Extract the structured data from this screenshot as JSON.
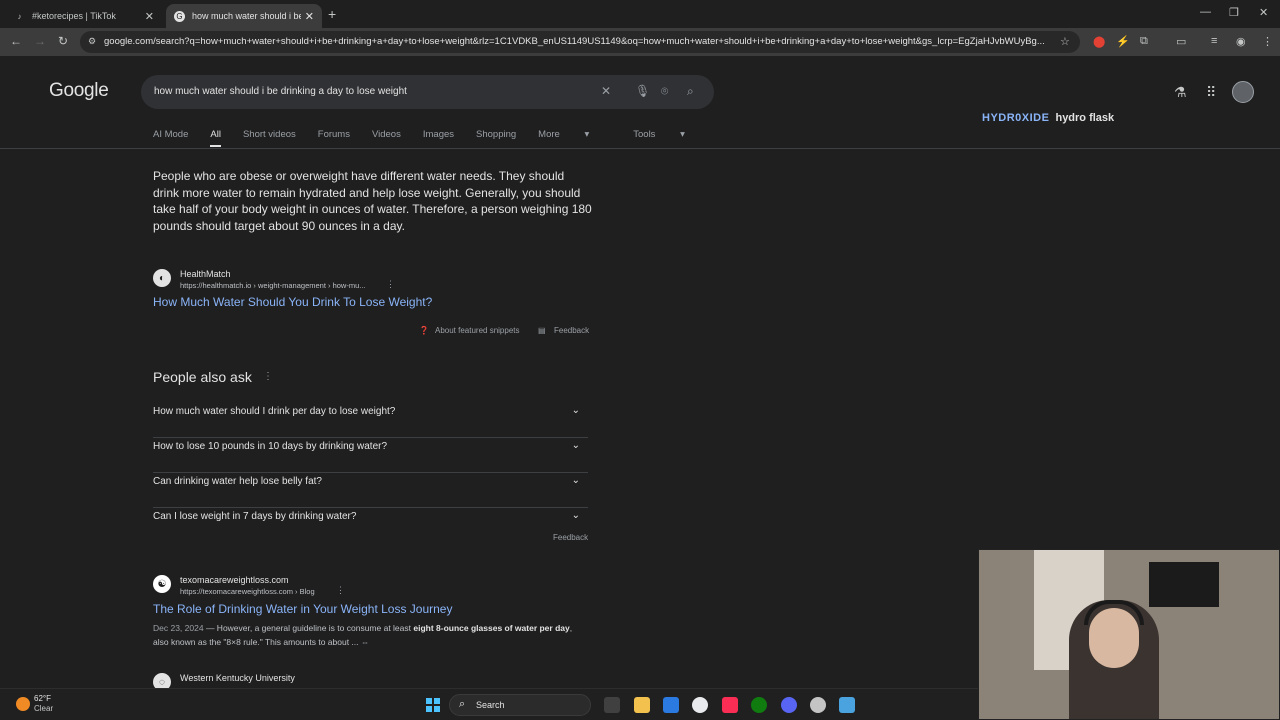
{
  "browser": {
    "tabs": [
      {
        "title": "#ketorecipes | TikTok",
        "active": false
      },
      {
        "title": "how much water should i be dr",
        "active": true
      }
    ],
    "url": "google.com/search?q=how+much+water+should+i+be+drinking+a+day+to+lose+weight&rlz=1C1VDKB_enUS1149US1149&oq=how+much+water+should+i+be+drinking+a+day+to+lose+weight&gs_lcrp=EgZjaHJvbWUyBg..."
  },
  "google": {
    "logo": "Google",
    "query": "how much water should i be drinking a day to lose weight",
    "nav_tabs": [
      "AI Mode",
      "All",
      "Short videos",
      "Forums",
      "Videos",
      "Images",
      "Shopping",
      "More",
      "Tools"
    ],
    "active_tab": "All"
  },
  "ad": {
    "brand1": "HYDR0XIDE",
    "brand2": "hydro flask"
  },
  "featured": {
    "text": "People who are obese or overweight have different water needs. They should drink more water to remain hydrated and help lose weight. Generally, you should take half of your body weight in ounces of water. Therefore, a person weighing 180 pounds should target about 90 ounces in a day.",
    "source_name": "HealthMatch",
    "source_url": "https://healthmatch.io › weight-management › how-mu...",
    "link_title": "How Much Water Should You Drink To Lose Weight?",
    "about_label": "About featured snippets",
    "feedback_label": "Feedback"
  },
  "paa": {
    "title": "People also ask",
    "questions": [
      "How much water should I drink per day to lose weight?",
      "How to lose 10 pounds in 10 days by drinking water?",
      "Can drinking water help lose belly fat?",
      "Can I lose weight in 7 days by drinking water?"
    ],
    "feedback_label": "Feedback"
  },
  "results": [
    {
      "site": "texomacareweightloss.com",
      "url": "https://texomacareweightloss.com › Blog",
      "title": "The Role of Drinking Water in Your Weight Loss Journey",
      "date": "Dec 23, 2024",
      "snippet_pre": " — However, a general guideline is to consume at least ",
      "snippet_bold": "eight 8-ounce glasses of water per day",
      "snippet_post": ", also known as the \"8×8 rule.\" This amounts to about ..."
    },
    {
      "site": "Western Kentucky University"
    }
  ],
  "taskbar": {
    "temp": "62°F",
    "condition": "Clear",
    "search_label": "Search"
  },
  "icons": {
    "back": "arrow-left-icon",
    "forward": "arrow-right-icon",
    "reload": "reload-icon",
    "mic": "mic-icon",
    "lens": "lens-icon",
    "search": "search-icon",
    "labs": "flask-icon",
    "apps": "apps-grid-icon"
  }
}
